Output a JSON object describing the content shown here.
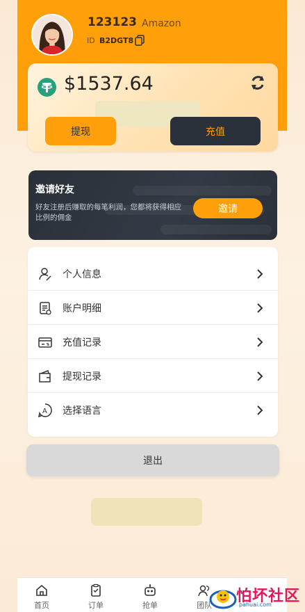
{
  "profile": {
    "username": "123123",
    "brand": "Amazon",
    "id_label": "ID",
    "id_value": "B2DGT8"
  },
  "wallet": {
    "balance": "$1537.64",
    "withdraw_label": "提现",
    "recharge_label": "充值"
  },
  "invite": {
    "title": "邀请好友",
    "description": "好友注册后赚取的每笔利润，您都将获得相应比例的佣金",
    "button_label": "邀请"
  },
  "menu": {
    "items": [
      {
        "label": "个人信息",
        "icon": "user-edit-icon"
      },
      {
        "label": "账户明细",
        "icon": "ledger-icon"
      },
      {
        "label": "充值记录",
        "icon": "card-record-icon"
      },
      {
        "label": "提现记录",
        "icon": "wallet-icon"
      },
      {
        "label": "选择语言",
        "icon": "language-icon"
      }
    ]
  },
  "logout_label": "退出",
  "tabbar": {
    "tabs": [
      {
        "label": "首页",
        "icon": "home-icon"
      },
      {
        "label": "订单",
        "icon": "clipboard-icon"
      },
      {
        "label": "抢单",
        "icon": "robot-icon"
      },
      {
        "label": "团队",
        "icon": "team-icon"
      }
    ]
  },
  "watermark": {
    "text": "怕坏社区",
    "sub": "pahuai.com"
  },
  "colors": {
    "accent": "#ff9f0a",
    "dark": "#2b313a",
    "background": "#fdf1e2"
  }
}
